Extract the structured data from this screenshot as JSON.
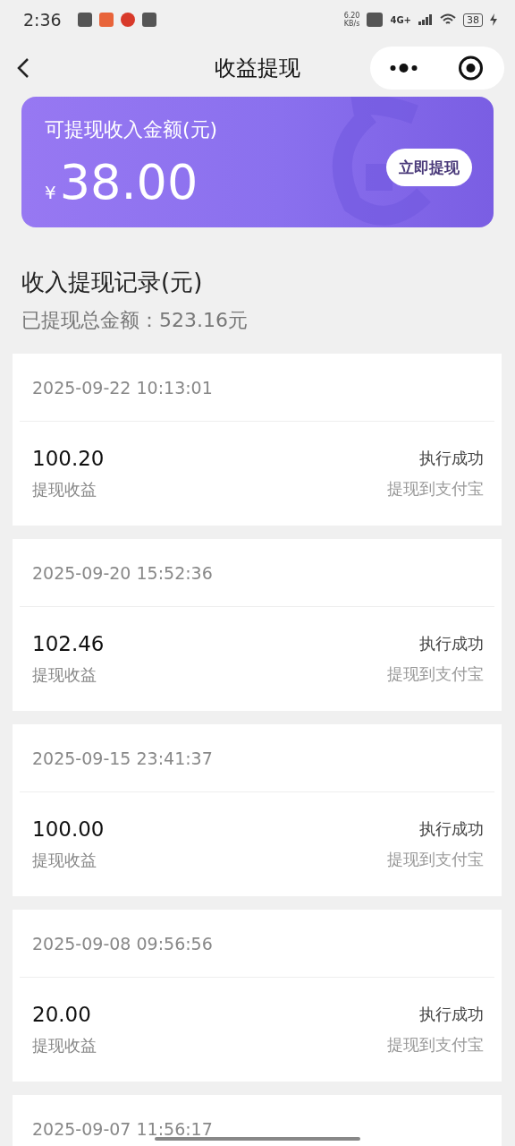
{
  "status_bar": {
    "time": "2:36",
    "speed": "6.20",
    "speed_unit": "KB/s",
    "network": "4G+",
    "battery": "38"
  },
  "nav": {
    "title": "收益提现"
  },
  "balance": {
    "label": "可提现收入金额(元)",
    "currency": "¥",
    "amount": "38.00",
    "button": "立即提现"
  },
  "records": {
    "title": "收入提现记录(元)",
    "total": "已提现总金额：523.16元",
    "items": [
      {
        "time": "2025-09-22 10:13:01",
        "amount": "100.20",
        "type": "提现收益",
        "status": "执行成功",
        "channel": "提现到支付宝"
      },
      {
        "time": "2025-09-20 15:52:36",
        "amount": "102.46",
        "type": "提现收益",
        "status": "执行成功",
        "channel": "提现到支付宝"
      },
      {
        "time": "2025-09-15 23:41:37",
        "amount": "100.00",
        "type": "提现收益",
        "status": "执行成功",
        "channel": "提现到支付宝"
      },
      {
        "time": "2025-09-08 09:56:56",
        "amount": "20.00",
        "type": "提现收益",
        "status": "执行成功",
        "channel": "提现到支付宝"
      },
      {
        "time": "2025-09-07 11:56:17"
      }
    ]
  }
}
